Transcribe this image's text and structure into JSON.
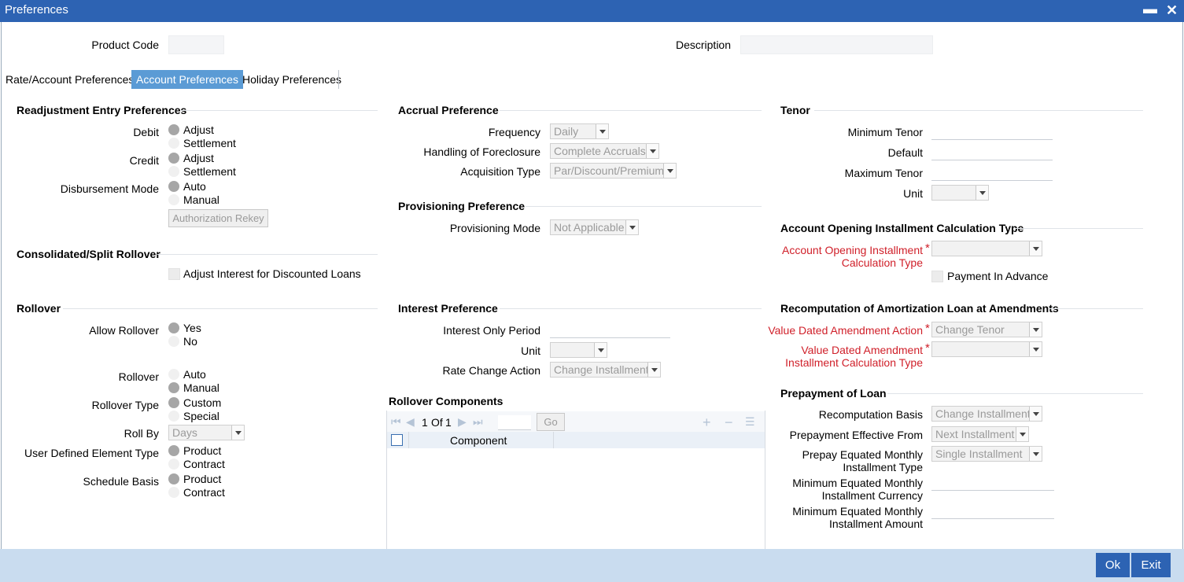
{
  "window": {
    "title": "Preferences",
    "minimize_glyph": "▬",
    "close_glyph": "✕"
  },
  "header": {
    "product_code_label": "Product Code",
    "product_code_value": "",
    "description_label": "Description",
    "description_value": ""
  },
  "tabs": [
    {
      "label": "Rate/Account Preferences",
      "active": false
    },
    {
      "label": "Account Preferences",
      "active": true
    },
    {
      "label": "Holiday Preferences",
      "active": false
    }
  ],
  "readjustment": {
    "title": "Readjustment Entry Preferences",
    "debit_label": "Debit",
    "debit_options": [
      "Adjust",
      "Settlement"
    ],
    "debit_selected": "Adjust",
    "credit_label": "Credit",
    "credit_options": [
      "Adjust",
      "Settlement"
    ],
    "credit_selected": "Adjust",
    "disbursement_label": "Disbursement Mode",
    "disbursement_options": [
      "Auto",
      "Manual"
    ],
    "disbursement_selected": "Auto",
    "auth_rekey_label": "Authorization Rekey"
  },
  "consolidated": {
    "title": "Consolidated/Split Rollover",
    "adjust_interest_label": "Adjust Interest for Discounted Loans",
    "adjust_interest_checked": false
  },
  "rollover": {
    "title": "Rollover",
    "allow_label": "Allow Rollover",
    "allow_options": [
      "Yes",
      "No"
    ],
    "allow_selected": "Yes",
    "rollover_label": "Rollover",
    "rollover_options": [
      "Auto",
      "Manual"
    ],
    "rollover_selected": "Manual",
    "type_label": "Rollover Type",
    "type_options": [
      "Custom",
      "Special"
    ],
    "type_selected": "Custom",
    "roll_by_label": "Roll By",
    "roll_by_value": "Days",
    "ude_label": "User Defined Element Type",
    "ude_options": [
      "Product",
      "Contract"
    ],
    "ude_selected": "Product",
    "schedule_label": "Schedule Basis",
    "schedule_options": [
      "Product",
      "Contract"
    ],
    "schedule_selected": "Product"
  },
  "accrual": {
    "title": "Accrual Preference",
    "frequency_label": "Frequency",
    "frequency_value": "Daily",
    "foreclosure_label": "Handling of Foreclosure",
    "foreclosure_value": "Complete Accruals",
    "acquisition_label": "Acquisition Type",
    "acquisition_value": "Par/Discount/Premium"
  },
  "provisioning": {
    "title": "Provisioning Preference",
    "mode_label": "Provisioning Mode",
    "mode_value": "Not Applicable"
  },
  "interest": {
    "title": "Interest Preference",
    "period_label": "Interest Only Period",
    "period_value": "",
    "unit_label": "Unit",
    "unit_value": "",
    "rate_change_label": "Rate Change Action",
    "rate_change_value": "Change Installment"
  },
  "rollover_components": {
    "title": "Rollover Components",
    "page_current": "1",
    "page_of": "Of",
    "page_total": "1",
    "go_label": "Go",
    "column_component": "Component"
  },
  "tenor": {
    "title": "Tenor",
    "min_label": "Minimum Tenor",
    "min_value": "",
    "default_label": "Default",
    "default_value": "",
    "max_label": "Maximum Tenor",
    "max_value": "",
    "unit_label": "Unit",
    "unit_value": ""
  },
  "opening_calc": {
    "title": "Account Opening Installment Calculation Type",
    "type_label_1": "Account Opening Installment",
    "type_label_2": "Calculation Type",
    "type_value": "",
    "payment_advance_label": "Payment In Advance",
    "payment_advance_checked": false
  },
  "recomputation": {
    "title": "Recomputation of Amortization Loan at Amendments",
    "vda_action_label": "Value Dated Amendment Action",
    "vda_action_value": "Change Tenor",
    "vda_calc_label_1": "Value Dated Amendment",
    "vda_calc_label_2": "Installment Calculation Type",
    "vda_calc_value": ""
  },
  "prepayment": {
    "title": "Prepayment of Loan",
    "basis_label": "Recomputation Basis",
    "basis_value": "Change Installment",
    "effective_label": "Prepayment Effective From",
    "effective_value": "Next Installment",
    "emi_type_label_1": "Prepay Equated Monthly",
    "emi_type_label_2": "Installment Type",
    "emi_type_value": "Single Installment",
    "min_ccy_label_1": "Minimum Equated Monthly",
    "min_ccy_label_2": "Installment Currency",
    "min_ccy_value": "",
    "min_amt_label_1": "Minimum Equated Monthly",
    "min_amt_label_2": "Installment Amount",
    "min_amt_value": ""
  },
  "footer": {
    "ok_label": "Ok",
    "exit_label": "Exit"
  },
  "required_mark": "*",
  "colors": {
    "title_bar": "#2d63b3",
    "active_tab": "#5b9bd5",
    "footer_bg": "#c9dcef",
    "required": "#d0202a"
  }
}
